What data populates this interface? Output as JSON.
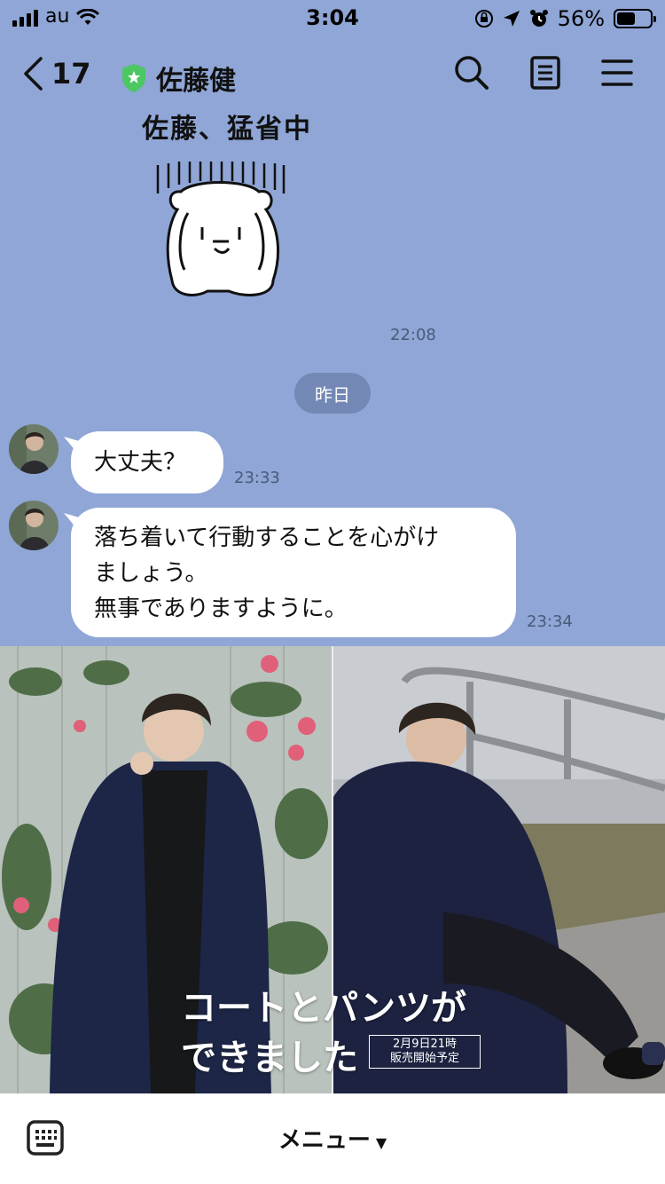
{
  "status_bar": {
    "carrier": "au",
    "time": "3:04",
    "battery_percent": "56%",
    "battery_level": 0.56
  },
  "navbar": {
    "back_count": "17",
    "title": "佐藤健"
  },
  "messages": {
    "sticker_caption": "佐藤、猛省中",
    "sticker_time": "22:08",
    "date_divider": "昨日",
    "msg1": {
      "text": "大丈夫？",
      "time": "23:33"
    },
    "msg2": {
      "line1": "落ち着いて行動することを心がけ",
      "line2": "ましょう。",
      "line3": "無事でありますように。",
      "time": "23:34"
    }
  },
  "banner": {
    "line1": "コートとパンツが",
    "line2": "できました",
    "badge_line1": "2月9日21時",
    "badge_line2": "販売開始予定"
  },
  "footer": {
    "menu_label": "メニュー",
    "menu_arrow": "▼"
  },
  "colors": {
    "chat_background": "#8fa6d6",
    "verified_badge": "#4cc764",
    "date_pill": "#7388b4"
  }
}
